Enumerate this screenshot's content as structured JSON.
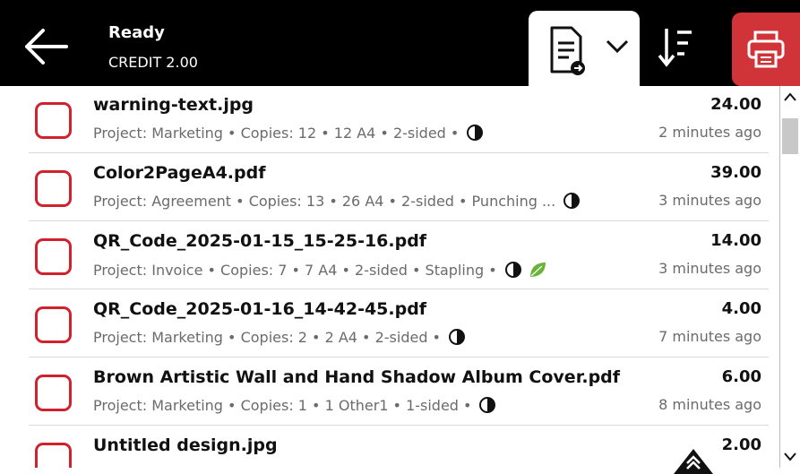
{
  "header": {
    "status": "Ready",
    "credit": "CREDIT 2.00",
    "icons": {
      "back": "back-arrow-icon",
      "document_select": "document-arrow-icon",
      "dropdown": "chevron-down-icon",
      "sort": "sort-descending-icon",
      "print": "printer-icon"
    }
  },
  "jobs": [
    {
      "name": "warning-text.jpg",
      "meta": "Project: Marketing • Copies: 12 • 12 A4 • 2-sided •",
      "price": "24.00",
      "time": "2 minutes ago",
      "eco": false
    },
    {
      "name": "Color2PageA4.pdf",
      "meta": "Project: Agreement • Copies: 13 • 26 A4 • 2-sided • Punching ...",
      "price": "39.00",
      "time": "3 minutes ago",
      "eco": false
    },
    {
      "name": "QR_Code_2025-01-15_15-25-16.pdf",
      "meta": "Project: Invoice • Copies: 7 • 7 A4 • 2-sided • Stapling •",
      "price": "14.00",
      "time": "3 minutes ago",
      "eco": true
    },
    {
      "name": "QR_Code_2025-01-16_14-42-45.pdf",
      "meta": "Project: Marketing • Copies: 2 • 2 A4 • 2-sided •",
      "price": "4.00",
      "time": "7 minutes ago",
      "eco": false
    },
    {
      "name": "Brown Artistic Wall and Hand Shadow Album Cover.pdf",
      "meta": "Project: Marketing • Copies: 1 • 1 Other1 • 1-sided •",
      "price": "6.00",
      "time": "8 minutes ago",
      "eco": false
    },
    {
      "name": "Untitled design.jpg",
      "meta": "",
      "price": "2.00",
      "time": "",
      "eco": false
    }
  ],
  "colors": {
    "accent": "#d13438",
    "checkbox": "#d0222e",
    "header_bg": "#000000"
  }
}
